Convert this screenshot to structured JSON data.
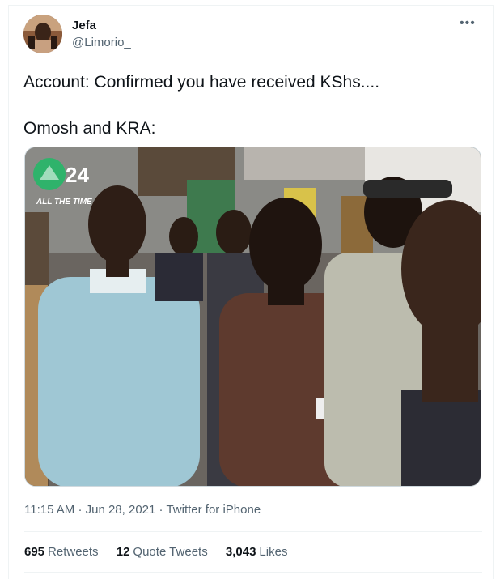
{
  "tweet": {
    "display_name": "Jefa",
    "handle": "@Limorio_",
    "more_icon": "•••",
    "text_line1": "Account: Confirmed you have received KShs....",
    "text_line2": "Omosh and KRA:",
    "media": {
      "channel_logo_number": "24",
      "channel_tagline": "ALL THE TIME"
    },
    "time": "11:15 AM",
    "date": "Jun 28, 2021",
    "separator": "·",
    "source": "Twitter for iPhone",
    "stats": {
      "retweets_count": "695",
      "retweets_label": "Retweets",
      "quote_count": "12",
      "quote_label": "Quote Tweets",
      "likes_count": "3,043",
      "likes_label": "Likes"
    }
  },
  "colors": {
    "text_primary": "#0f1419",
    "text_secondary": "#536471",
    "border": "#eff3f4",
    "logo_green": "#2fb36b"
  }
}
